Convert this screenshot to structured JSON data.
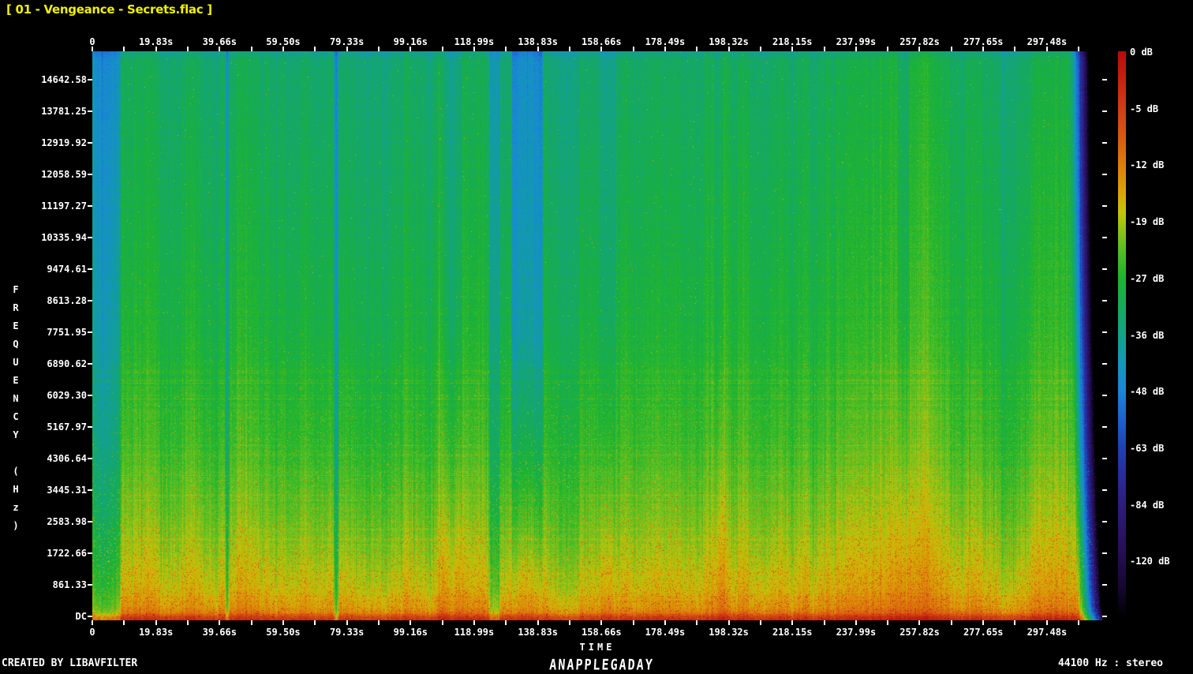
{
  "title": "[ 01 - Vengeance - Secrets.flac ]",
  "footer": {
    "left": "CREATED BY LIBAVFILTER",
    "center_logo": "ANAPPLEGADAY",
    "right": "44100 Hz : stereo"
  },
  "chart_data": {
    "type": "heatmap",
    "subtype": "audio-spectrogram",
    "title": "[ 01 - Vengeance - Secrets.flac ]",
    "xlabel": "TIME",
    "ylabel": "FREQUENCY (Hz)",
    "sample_rate_label": "44100 Hz : stereo",
    "generator": "CREATED BY LIBAVFILTER",
    "x_ticks": [
      {
        "label": "0",
        "s": 0
      },
      {
        "label": "19.83s",
        "s": 19.83
      },
      {
        "label": "39.66s",
        "s": 39.66
      },
      {
        "label": "59.50s",
        "s": 59.5
      },
      {
        "label": "79.33s",
        "s": 79.33
      },
      {
        "label": "99.16s",
        "s": 99.16
      },
      {
        "label": "118.99s",
        "s": 118.99
      },
      {
        "label": "138.83s",
        "s": 138.83
      },
      {
        "label": "158.66s",
        "s": 158.66
      },
      {
        "label": "178.49s",
        "s": 178.49
      },
      {
        "label": "198.32s",
        "s": 198.32
      },
      {
        "label": "218.15s",
        "s": 218.15
      },
      {
        "label": "237.99s",
        "s": 237.99
      },
      {
        "label": "257.82s",
        "s": 257.82
      },
      {
        "label": "277.65s",
        "s": 277.65
      },
      {
        "label": "297.48s",
        "s": 297.48
      }
    ],
    "y_ticks": [
      {
        "label": "14642.58",
        "hz": 14642.58
      },
      {
        "label": "13781.25",
        "hz": 13781.25
      },
      {
        "label": "12919.92",
        "hz": 12919.92
      },
      {
        "label": "12058.59",
        "hz": 12058.59
      },
      {
        "label": "11197.27",
        "hz": 11197.27
      },
      {
        "label": "10335.94",
        "hz": 10335.94
      },
      {
        "label": "9474.61",
        "hz": 9474.61
      },
      {
        "label": "8613.28",
        "hz": 8613.28
      },
      {
        "label": "7751.95",
        "hz": 7751.95
      },
      {
        "label": "6890.62",
        "hz": 6890.62
      },
      {
        "label": "6029.30",
        "hz": 6029.3
      },
      {
        "label": "5167.97",
        "hz": 5167.97
      },
      {
        "label": "4306.64",
        "hz": 4306.64
      },
      {
        "label": "3445.31",
        "hz": 3445.31
      },
      {
        "label": "2583.98",
        "hz": 2583.98
      },
      {
        "label": "1722.66",
        "hz": 1722.66
      },
      {
        "label": "861.33",
        "hz": 861.33
      },
      {
        "label": "DC",
        "hz": 0
      }
    ],
    "colorbar": {
      "labels": [
        {
          "label": "0 dB",
          "frac": 0.0
        },
        {
          "label": "-5 dB",
          "frac": 0.1
        },
        {
          "label": "-12 dB",
          "frac": 0.2
        },
        {
          "label": "-19 dB",
          "frac": 0.3
        },
        {
          "label": "-27 dB",
          "frac": 0.4
        },
        {
          "label": "-36 dB",
          "frac": 0.5
        },
        {
          "label": "-48 dB",
          "frac": 0.6
        },
        {
          "label": "-63 dB",
          "frac": 0.7
        },
        {
          "label": "-84 dB",
          "frac": 0.8
        },
        {
          "label": "-120 dB",
          "frac": 0.9
        }
      ],
      "gradient_stops": [
        {
          "frac": 0.0,
          "color": "#b80a0a"
        },
        {
          "frac": 0.05,
          "color": "#c42310"
        },
        {
          "frac": 0.1,
          "color": "#cf3d15"
        },
        {
          "frac": 0.16,
          "color": "#d95f10"
        },
        {
          "frac": 0.2,
          "color": "#de7d0c"
        },
        {
          "frac": 0.25,
          "color": "#d9a407"
        },
        {
          "frac": 0.285,
          "color": "#c6c40a"
        },
        {
          "frac": 0.32,
          "color": "#86c31a"
        },
        {
          "frac": 0.36,
          "color": "#4abd25"
        },
        {
          "frac": 0.4,
          "color": "#1eb42f"
        },
        {
          "frac": 0.45,
          "color": "#17ab5a"
        },
        {
          "frac": 0.5,
          "color": "#13a384"
        },
        {
          "frac": 0.55,
          "color": "#1497bb"
        },
        {
          "frac": 0.6,
          "color": "#1b86d8"
        },
        {
          "frac": 0.65,
          "color": "#1e62cf"
        },
        {
          "frac": 0.7,
          "color": "#1f41b4"
        },
        {
          "frac": 0.75,
          "color": "#282c99"
        },
        {
          "frac": 0.8,
          "color": "#2d1d80"
        },
        {
          "frac": 0.85,
          "color": "#2a1466"
        },
        {
          "frac": 0.9,
          "color": "#220c4e"
        },
        {
          "frac": 0.95,
          "color": "#140730"
        },
        {
          "frac": 1.0,
          "color": "#000000"
        }
      ]
    },
    "audio_end_s": 304.7,
    "quiet_bands": [
      {
        "start_s": 0,
        "end_s": 8.6,
        "strength": 0.1,
        "shape": "full"
      },
      {
        "start_s": 41.6,
        "end_s": 42.3,
        "strength": 0.16,
        "shape": "full"
      },
      {
        "start_s": 75.6,
        "end_s": 76.3,
        "strength": 0.16,
        "shape": "full"
      },
      {
        "start_s": 109.0,
        "end_s": 115.0,
        "strength": 0.055,
        "shape": "upper"
      },
      {
        "start_s": 123.7,
        "end_s": 126.7,
        "strength": 0.09,
        "shape": "full"
      },
      {
        "start_s": 130.6,
        "end_s": 140.2,
        "strength": 0.14,
        "shape": "funnel"
      },
      {
        "start_s": 158.2,
        "end_s": 162.6,
        "strength": 0.055,
        "shape": "upper"
      },
      {
        "start_s": 194.0,
        "end_s": 196.5,
        "strength": 0.045,
        "shape": "upper"
      },
      {
        "start_s": 251.0,
        "end_s": 254.5,
        "strength": 0.045,
        "shape": "upper"
      }
    ]
  }
}
